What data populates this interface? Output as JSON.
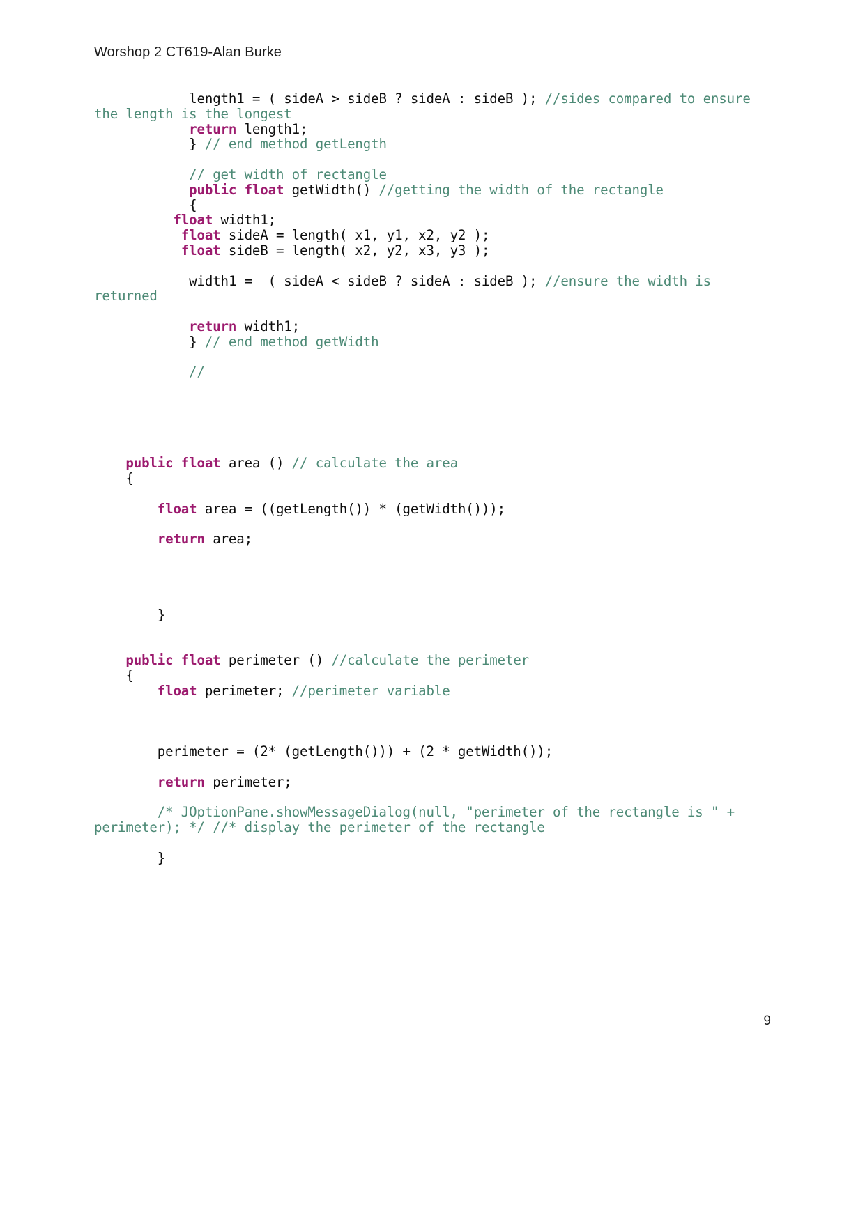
{
  "document": {
    "header": "Worshop 2 CT619-Alan Burke",
    "page_number": "9",
    "colors": {
      "text": "#0d0d0d",
      "keyword": "#9c1a6e",
      "comment": "#4d8a76",
      "background": "#ffffff"
    },
    "code_lines": [
      {
        "indent": "            ",
        "segments": [
          {
            "text": "length1 = ( sideA > sideB ? sideA : sideB ); ",
            "style": "text"
          },
          {
            "text": "//sides compared to ensure the length is the longest",
            "style": "comment"
          }
        ]
      },
      {
        "indent": "            ",
        "segments": [
          {
            "text": "return",
            "style": "keyword"
          },
          {
            "text": " length1;",
            "style": "text"
          }
        ]
      },
      {
        "indent": "            ",
        "segments": [
          {
            "text": "} ",
            "style": "text"
          },
          {
            "text": "// end method getLength",
            "style": "comment"
          }
        ]
      },
      {
        "indent": "",
        "segments": []
      },
      {
        "indent": "            ",
        "segments": [
          {
            "text": "// get width of rectangle",
            "style": "comment"
          }
        ]
      },
      {
        "indent": "            ",
        "segments": [
          {
            "text": "public float",
            "style": "keyword"
          },
          {
            "text": " getWidth() ",
            "style": "text"
          },
          {
            "text": "//getting the width of the rectangle",
            "style": "comment"
          }
        ]
      },
      {
        "indent": "            ",
        "segments": [
          {
            "text": "{",
            "style": "text"
          }
        ]
      },
      {
        "indent": "          ",
        "segments": [
          {
            "text": "float",
            "style": "keyword"
          },
          {
            "text": " width1;",
            "style": "text"
          }
        ]
      },
      {
        "indent": "           ",
        "segments": [
          {
            "text": "float",
            "style": "keyword"
          },
          {
            "text": " sideA = length( x1, y1, x2, y2 );",
            "style": "text"
          }
        ]
      },
      {
        "indent": "           ",
        "segments": [
          {
            "text": "float",
            "style": "keyword"
          },
          {
            "text": " sideB = length( x2, y2, x3, y3 );",
            "style": "text"
          }
        ]
      },
      {
        "indent": "",
        "segments": []
      },
      {
        "indent": "            ",
        "segments": [
          {
            "text": "width1 =  ( sideA < sideB ? sideA : sideB ); ",
            "style": "text"
          },
          {
            "text": "//ensure the width is returned",
            "style": "comment"
          }
        ]
      },
      {
        "indent": "",
        "segments": []
      },
      {
        "indent": "            ",
        "segments": [
          {
            "text": "return",
            "style": "keyword"
          },
          {
            "text": " width1;",
            "style": "text"
          }
        ]
      },
      {
        "indent": "            ",
        "segments": [
          {
            "text": "} ",
            "style": "text"
          },
          {
            "text": "// end method getWidth",
            "style": "comment"
          }
        ]
      },
      {
        "indent": "",
        "segments": []
      },
      {
        "indent": "            ",
        "segments": [
          {
            "text": "//",
            "style": "comment"
          }
        ]
      },
      {
        "indent": "",
        "segments": []
      },
      {
        "indent": "",
        "segments": []
      },
      {
        "indent": "",
        "segments": []
      },
      {
        "indent": "",
        "segments": []
      },
      {
        "indent": "",
        "segments": []
      },
      {
        "indent": "    ",
        "segments": [
          {
            "text": "public float",
            "style": "keyword"
          },
          {
            "text": " area () ",
            "style": "text"
          },
          {
            "text": "// calculate the area",
            "style": "comment"
          }
        ]
      },
      {
        "indent": "    ",
        "segments": [
          {
            "text": "{",
            "style": "text"
          }
        ]
      },
      {
        "indent": "",
        "segments": []
      },
      {
        "indent": "        ",
        "segments": [
          {
            "text": "float",
            "style": "keyword"
          },
          {
            "text": " area = ((getLength()) * (getWidth()));",
            "style": "text"
          }
        ]
      },
      {
        "indent": "",
        "segments": []
      },
      {
        "indent": "        ",
        "segments": [
          {
            "text": "return",
            "style": "keyword"
          },
          {
            "text": " area;",
            "style": "text"
          }
        ]
      },
      {
        "indent": "",
        "segments": []
      },
      {
        "indent": "",
        "segments": []
      },
      {
        "indent": "",
        "segments": []
      },
      {
        "indent": "",
        "segments": []
      },
      {
        "indent": "        ",
        "segments": [
          {
            "text": "}",
            "style": "text"
          }
        ]
      },
      {
        "indent": "",
        "segments": []
      },
      {
        "indent": "",
        "segments": []
      },
      {
        "indent": "    ",
        "segments": [
          {
            "text": "public float",
            "style": "keyword"
          },
          {
            "text": " perimeter () ",
            "style": "text"
          },
          {
            "text": "//calculate the perimeter",
            "style": "comment"
          }
        ]
      },
      {
        "indent": "    ",
        "segments": [
          {
            "text": "{",
            "style": "text"
          }
        ]
      },
      {
        "indent": "        ",
        "segments": [
          {
            "text": "float",
            "style": "keyword"
          },
          {
            "text": " perimeter; ",
            "style": "text"
          },
          {
            "text": "//perimeter variable",
            "style": "comment"
          }
        ]
      },
      {
        "indent": "",
        "segments": []
      },
      {
        "indent": "",
        "segments": []
      },
      {
        "indent": "",
        "segments": []
      },
      {
        "indent": "        ",
        "segments": [
          {
            "text": "perimeter = (2* (getLength())) + (2 * getWidth());",
            "style": "text"
          }
        ]
      },
      {
        "indent": "",
        "segments": []
      },
      {
        "indent": "        ",
        "segments": [
          {
            "text": "return",
            "style": "keyword"
          },
          {
            "text": " perimeter;",
            "style": "text"
          }
        ]
      },
      {
        "indent": "",
        "segments": []
      },
      {
        "indent": "        ",
        "segments": [
          {
            "text": "/* JOptionPane.showMessageDialog(null, \"perimeter of the rectangle is \" + perimeter); */ //* display the perimeter of the rectangle",
            "style": "comment"
          }
        ]
      },
      {
        "indent": "",
        "segments": []
      },
      {
        "indent": "        ",
        "segments": [
          {
            "text": "}",
            "style": "text"
          }
        ]
      }
    ]
  }
}
